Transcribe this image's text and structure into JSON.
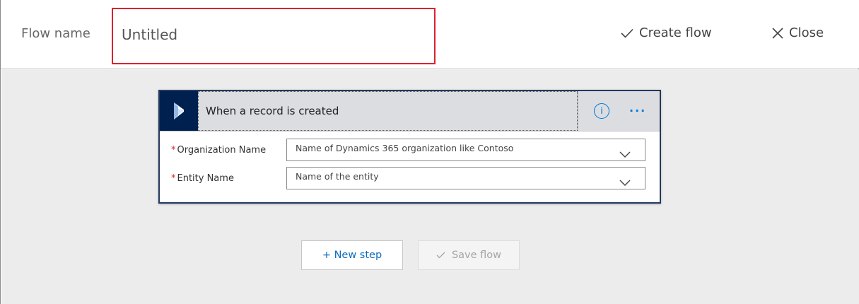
{
  "header": {
    "flow_name_label": "Flow name",
    "flow_name_value": "Untitled",
    "create_flow_label": "Create flow",
    "close_label": "Close"
  },
  "trigger": {
    "title": "When a record is created",
    "info_icon": "info-icon",
    "more_icon": "more-icon",
    "more_glyph": "···",
    "info_glyph": "i",
    "fields": [
      {
        "label": "Organization Name",
        "required_mark": "*",
        "placeholder": "Name of Dynamics 365 organization like Contoso"
      },
      {
        "label": "Entity Name",
        "required_mark": "*",
        "placeholder": "Name of the entity"
      }
    ]
  },
  "actions": {
    "new_step_label": "+ New step",
    "save_flow_label": "Save flow"
  },
  "colors": {
    "accent": "#0078d4",
    "required": "#d9232e",
    "highlight_border": "#d9232e",
    "dynamics_logo_bg": "#002050",
    "card_border": "#243a5e"
  }
}
